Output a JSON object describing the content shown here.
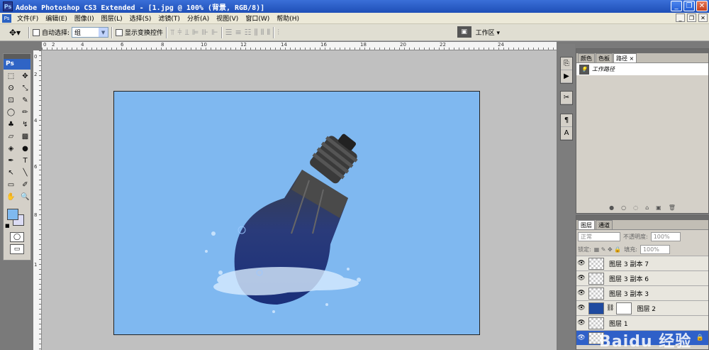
{
  "window": {
    "title": "Adobe Photoshop CS3 Extended - [1.jpg @ 100% (背景, RGB/8)]",
    "app_icon": "Ps",
    "controls": [
      "_",
      "❐",
      "✕"
    ]
  },
  "menu": {
    "items": [
      "文件(F)",
      "编辑(E)",
      "图像(I)",
      "图层(L)",
      "选择(S)",
      "滤镜(T)",
      "分析(A)",
      "视图(V)",
      "窗口(W)",
      "帮助(H)"
    ],
    "doc_controls": [
      "_",
      "❐",
      "✕"
    ]
  },
  "options": {
    "tool_icon": "move-tool-icon",
    "auto_select_label": "自动选择:",
    "auto_select_value": "组",
    "show_transform_label": "显示变换控件",
    "workspace_label": "工作区"
  },
  "toolbox": {
    "logo": "Ps",
    "tools": [
      "⬚",
      "✥",
      "ʘ",
      "⤡",
      "⊡",
      "✎",
      "◯",
      "✏",
      "♣",
      "↯",
      "▱",
      "▩",
      "◈",
      "●",
      "✒",
      "T",
      "↖",
      "╲",
      "▭",
      "✐",
      "✋",
      "🔍"
    ]
  },
  "rulers": {
    "top": [
      "0",
      "2",
      "4",
      "6",
      "8",
      "10",
      "12",
      "14",
      "16",
      "18",
      "20",
      "22",
      "24"
    ],
    "left": [
      "0",
      "2",
      "4",
      "6",
      "8",
      "1"
    ]
  },
  "paths_panel": {
    "tabs": [
      "颜色",
      "色板",
      "路径"
    ],
    "active_tab": 2,
    "path_name": "工作路径"
  },
  "layers_panel": {
    "tabs": [
      "图层",
      "通道"
    ],
    "blend_mode": "正常",
    "opacity_label": "不透明度:",
    "opacity_value": "100%",
    "lock_label": "锁定:",
    "fill_label": "填充:",
    "fill_value": "100%",
    "layers": [
      {
        "name": "图层 3 副本 7",
        "thumb": "checker"
      },
      {
        "name": "图层 3 副本 6",
        "thumb": "checker"
      },
      {
        "name": "图层 3 副本 3",
        "thumb": "checker"
      },
      {
        "name": "图层 2",
        "thumb": "blue",
        "mask": true
      },
      {
        "name": "图层 1",
        "thumb": "checker"
      },
      {
        "name": "",
        "thumb": "checker",
        "selected": true
      }
    ]
  },
  "watermark": "Baidu 经验",
  "colors": {
    "foreground": "#7fb9ef",
    "background": "#dcdcf4",
    "canvas_bg": "#7fb8f0"
  }
}
